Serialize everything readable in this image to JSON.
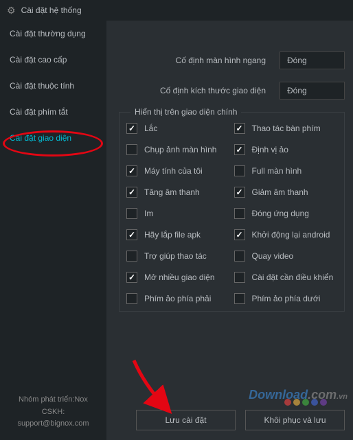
{
  "title": "Cài đặt hệ thống",
  "sidebar": {
    "items": [
      {
        "label": "Cài đặt thường dụng"
      },
      {
        "label": "Cài đặt cao cấp"
      },
      {
        "label": "Cài đặt thuộc tính"
      },
      {
        "label": "Cài đặt phím tắt"
      },
      {
        "label": "Cài đặt giao diện"
      }
    ]
  },
  "footer": {
    "line1": "Nhóm phát triển:Nox",
    "line2": "CSKH:",
    "line3": "support@bignox.com"
  },
  "rows": {
    "fixed_horizontal": {
      "label": "Cố định màn hình ngang",
      "value": "Đóng"
    },
    "fixed_size": {
      "label": "Cố định kích thước giao diện",
      "value": "Đóng"
    }
  },
  "fieldset": {
    "legend": "Hiển thị trên giao diện chính",
    "checks": [
      {
        "label": "Lắc",
        "checked": true
      },
      {
        "label": "Thao tác bàn phím",
        "checked": true
      },
      {
        "label": "Chụp ảnh màn hình",
        "checked": false
      },
      {
        "label": "Định vị ảo",
        "checked": true
      },
      {
        "label": "Máy tính của tôi",
        "checked": true
      },
      {
        "label": "Full màn hình",
        "checked": false
      },
      {
        "label": "Tăng âm thanh",
        "checked": true
      },
      {
        "label": "Giảm âm thanh",
        "checked": true
      },
      {
        "label": "Im",
        "checked": false
      },
      {
        "label": "Đóng ứng dụng",
        "checked": false
      },
      {
        "label": "Hãy lắp file apk",
        "checked": true
      },
      {
        "label": "Khởi động lại android",
        "checked": true
      },
      {
        "label": "Trợ giúp thao tác",
        "checked": false
      },
      {
        "label": "Quay video",
        "checked": false
      },
      {
        "label": "Mở nhiều giao diện",
        "checked": true
      },
      {
        "label": "Cài đặt cần điều khiển",
        "checked": false
      },
      {
        "label": "Phím ảo phía phải",
        "checked": false
      },
      {
        "label": "Phím ảo phía dưới",
        "checked": false
      }
    ]
  },
  "buttons": {
    "save": "Lưu cài đặt",
    "restore": "Khôi phục và lưu"
  },
  "watermark": {
    "brand": "Download",
    "suffix": ".com",
    "tld": ".vn"
  },
  "dot_colors": [
    "#d04040",
    "#d0a040",
    "#40a040",
    "#4060c0",
    "#7040a0"
  ]
}
